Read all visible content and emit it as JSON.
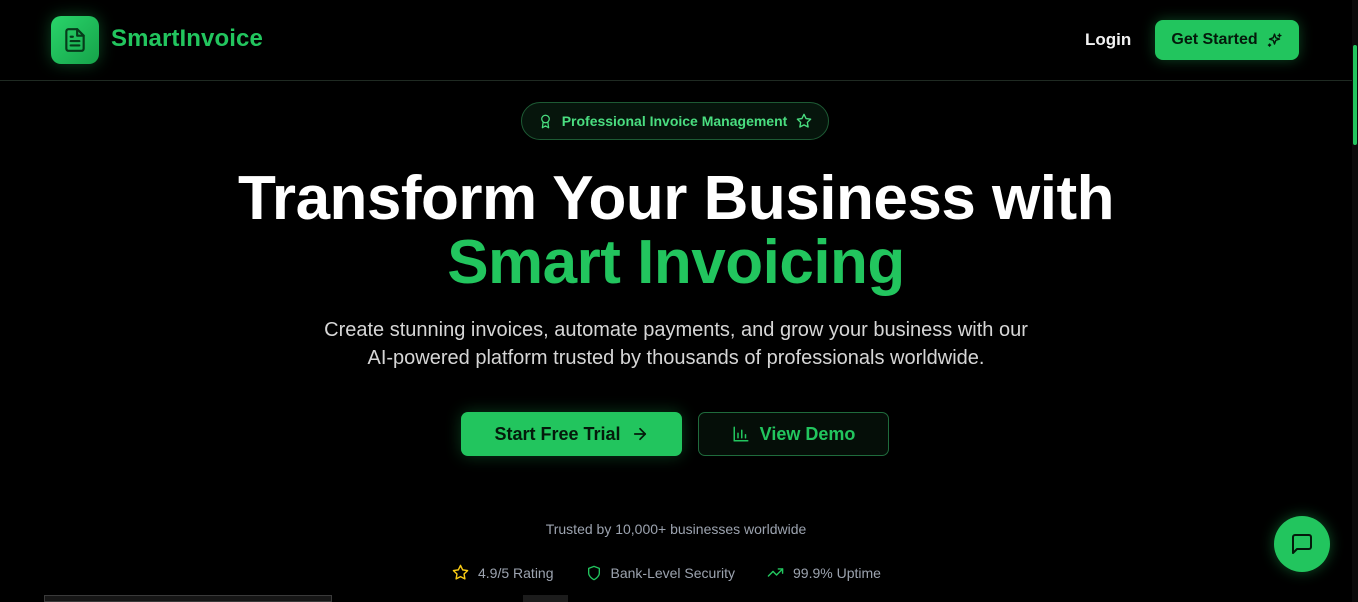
{
  "nav": {
    "brand": "SmartInvoice",
    "login_label": "Login",
    "get_started_label": "Get Started"
  },
  "hero": {
    "badge_label": "Professional Invoice Management",
    "title_line1": "Transform Your Business with",
    "title_line2": "Smart Invoicing",
    "subtitle_line1": "Create stunning invoices, automate payments, and grow your business with our",
    "subtitle_line2": "AI-powered platform trusted by thousands of professionals worldwide.",
    "primary_cta": "Start Free Trial",
    "secondary_cta": "View Demo"
  },
  "trust": {
    "headline": "Trusted by 10,000+ businesses worldwide",
    "stats": [
      {
        "icon": "star-icon",
        "label": "4.9/5 Rating"
      },
      {
        "icon": "shield-icon",
        "label": "Bank-Level Security"
      },
      {
        "icon": "trending-up-icon",
        "label": "99.9% Uptime"
      }
    ]
  },
  "colors": {
    "accent": "#22c55e",
    "background": "#000000",
    "star": "#facc15"
  }
}
